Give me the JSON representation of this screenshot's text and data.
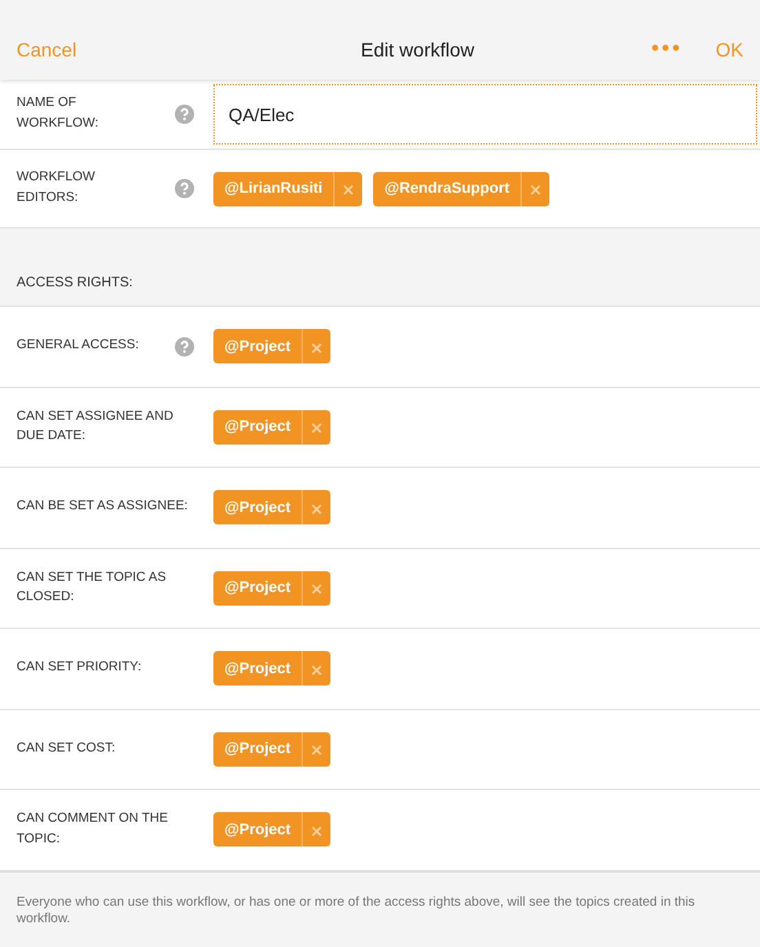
{
  "header": {
    "cancel": "Cancel",
    "title": "Edit workflow",
    "more": "•••",
    "ok": "OK"
  },
  "name_field": {
    "label": "NAME OF WORKFLOW:",
    "help": true,
    "value": "QA/Elec"
  },
  "editors": {
    "label": "WORKFLOW EDITORS:",
    "help": true,
    "tags": [
      "@LirianRusiti",
      "@RendraSupport"
    ]
  },
  "section_title": "ACCESS RIGHTS:",
  "rights": [
    {
      "label": "GENERAL ACCESS:",
      "help": true,
      "tags": [
        "@Project"
      ]
    },
    {
      "label": "CAN SET ASSIGNEE AND DUE DATE:",
      "help": false,
      "tags": [
        "@Project"
      ]
    },
    {
      "label": "CAN BE SET AS ASSIGNEE:",
      "help": false,
      "tags": [
        "@Project"
      ]
    },
    {
      "label": "CAN SET THE TOPIC AS CLOSED:",
      "help": false,
      "tags": [
        "@Project"
      ]
    },
    {
      "label": "CAN SET PRIORITY:",
      "help": false,
      "tags": [
        "@Project"
      ]
    },
    {
      "label": "CAN SET COST:",
      "help": false,
      "tags": [
        "@Project"
      ]
    },
    {
      "label": "CAN COMMENT ON THE TOPIC:",
      "help": false,
      "tags": [
        "@Project"
      ]
    }
  ],
  "footer_note": "Everyone who can use this workflow, or has one or more of the access rights above, will see the topics created in this workflow."
}
